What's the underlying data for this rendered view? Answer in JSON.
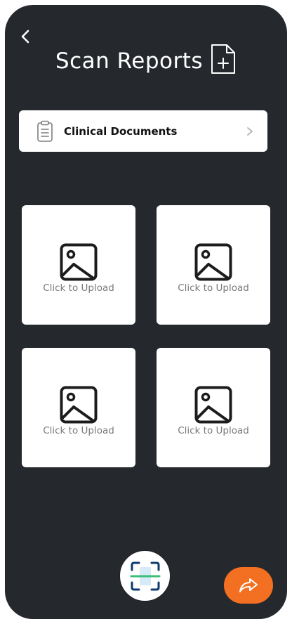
{
  "header": {
    "title": "Scan Reports",
    "back_icon": "chevron-left-icon",
    "title_icon": "file-add-icon"
  },
  "category": {
    "label": "Clinical Documents",
    "icon": "clipboard-icon",
    "chevron_icon": "chevron-right-icon"
  },
  "upload_tiles": [
    {
      "label": "Click to Upload",
      "icon": "image-icon"
    },
    {
      "label": "Click to Upload",
      "icon": "image-icon"
    },
    {
      "label": "Click to Upload",
      "icon": "image-icon"
    },
    {
      "label": "Click to Upload",
      "icon": "image-icon"
    }
  ],
  "actions": {
    "scan_icon": "scan-icon",
    "share_icon": "share-icon"
  },
  "colors": {
    "background": "#25282d",
    "accent": "#f36f21",
    "card": "#ffffff",
    "muted_text": "#7a7a7a",
    "scan_line": "#3bbf7a",
    "scan_frame": "#0e3b6e"
  }
}
